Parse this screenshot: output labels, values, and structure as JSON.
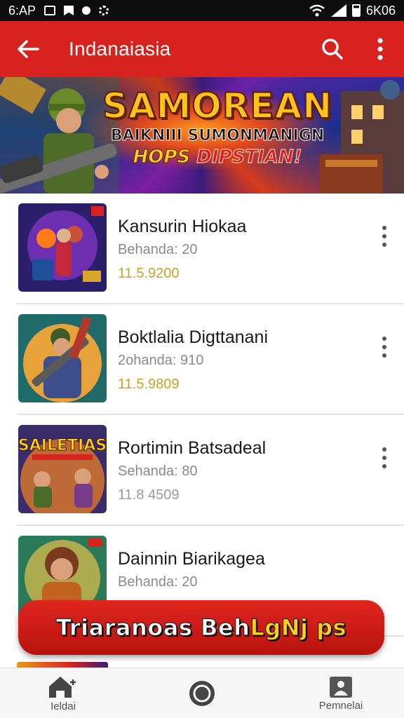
{
  "status_bar": {
    "time": "6:AP",
    "right_text": "6K06",
    "icons": [
      "notes-icon",
      "flag-icon",
      "circle-icon",
      "settings-icon",
      "wifi-icon",
      "signal-icon",
      "battery-icon"
    ]
  },
  "app_bar": {
    "title": "Indanaiasia",
    "background": "#d8221f",
    "icons": [
      "back-arrow-icon",
      "search-icon",
      "more-vertical-icon"
    ]
  },
  "banner": {
    "line1": "SAMOREAN",
    "line2": "BAIKNIII SUMONMANIGN",
    "line3_a": "HOPS ",
    "line3_b": "DIPSTIAN!"
  },
  "items": [
    {
      "name": "Kansurin Hiokaa",
      "meta": "Behanda: 20",
      "price": "11.5.9200",
      "price_color": "gold"
    },
    {
      "name": "Boktlalia Digttanani",
      "meta": "2ohanda: 910",
      "price": "11.5.9809",
      "price_color": "gold"
    },
    {
      "name": "Rortimin Batsadeal",
      "meta": "Sehanda: 80",
      "price": "11.8 4509",
      "price_color": "grey",
      "thumb_text": "SAILETIAS"
    },
    {
      "name": "Dainnin Biarikagea",
      "meta": "Behanda: 20",
      "price": "",
      "price_color": "grey"
    }
  ],
  "cta": {
    "label_a": "Triaranoas Beh",
    "label_b": "LgNj ps"
  },
  "bottom_nav": {
    "home_label": "Ieldai",
    "right_label": "Pemnelai"
  },
  "colors": {
    "accent": "#d8221f",
    "gold": "#c9a227"
  }
}
